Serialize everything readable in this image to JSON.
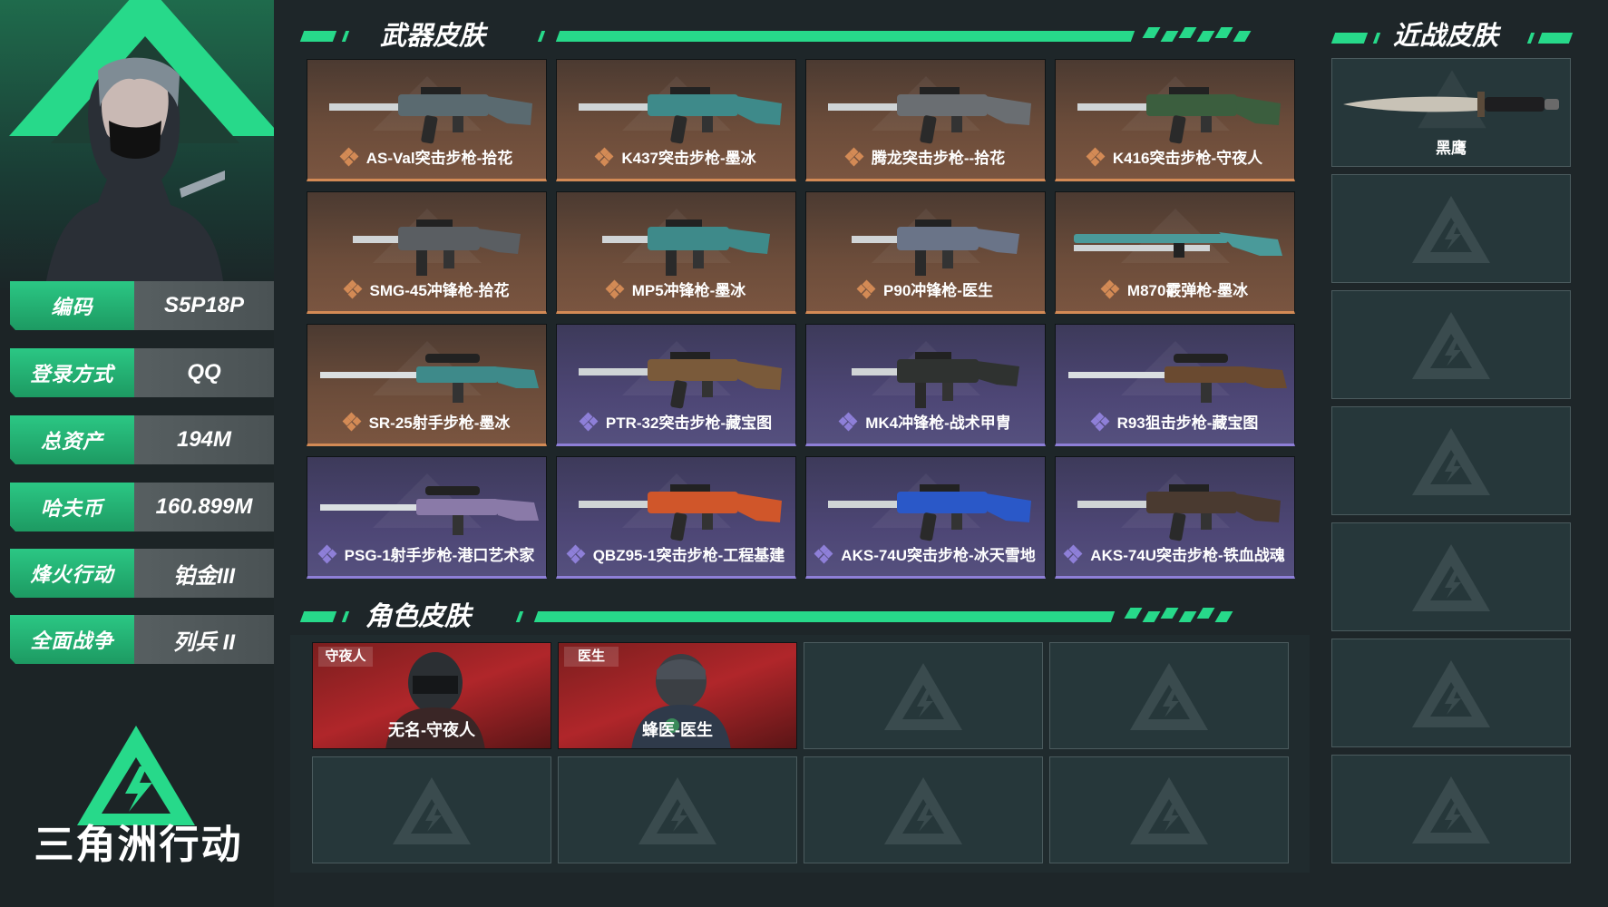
{
  "profile": {
    "rows": [
      {
        "key": "编码",
        "value": "S5P18P"
      },
      {
        "key": "登录方式",
        "value": "QQ"
      },
      {
        "key": "总资产",
        "value": "194M"
      },
      {
        "key": "哈夫币",
        "value": "160.899M"
      },
      {
        "key": "烽火行动",
        "value": "铂金III"
      },
      {
        "key": "全面战争",
        "value": "列兵 II"
      }
    ],
    "logo_text": "三角洲行动"
  },
  "weapon_section": {
    "title": "武器皮肤"
  },
  "weapons": [
    {
      "name": "AS-Val突击步枪-拾花",
      "rarity": "brown",
      "icon": "rifle-icon",
      "accent": "#5a6a70"
    },
    {
      "name": "K437突击步枪-墨冰",
      "rarity": "brown",
      "icon": "rifle-icon",
      "accent": "#3e8a8a"
    },
    {
      "name": "腾龙突击步枪--拾花",
      "rarity": "brown",
      "icon": "rifle-icon",
      "accent": "#6a6e72"
    },
    {
      "name": "K416突击步枪-守夜人",
      "rarity": "brown",
      "icon": "rifle-icon",
      "accent": "#3b5e3e"
    },
    {
      "name": "SMG-45冲锋枪-拾花",
      "rarity": "brown",
      "icon": "smg-icon",
      "accent": "#5a5e62"
    },
    {
      "name": "MP5冲锋枪-墨冰",
      "rarity": "brown",
      "icon": "smg-icon",
      "accent": "#3e8a8a"
    },
    {
      "name": "P90冲锋枪-医生",
      "rarity": "brown",
      "icon": "smg-icon",
      "accent": "#6a7488"
    },
    {
      "name": "M870霰弹枪-墨冰",
      "rarity": "brown",
      "icon": "shotgun-icon",
      "accent": "#4a9a9a"
    },
    {
      "name": "SR-25射手步枪-墨冰",
      "rarity": "brown",
      "icon": "sniper-icon",
      "accent": "#3e8a8a"
    },
    {
      "name": "PTR-32突击步枪-藏宝图",
      "rarity": "purple",
      "icon": "rifle-icon",
      "accent": "#7a5a3a"
    },
    {
      "name": "MK4冲锋枪-战术甲胄",
      "rarity": "purple",
      "icon": "smg-icon",
      "accent": "#2f3230"
    },
    {
      "name": "R93狙击步枪-藏宝图",
      "rarity": "purple",
      "icon": "sniper-icon",
      "accent": "#6a4a30"
    },
    {
      "name": "PSG-1射手步枪-港口艺术家",
      "rarity": "purple",
      "icon": "sniper-icon",
      "accent": "#8a7aa8"
    },
    {
      "name": "QBZ95-1突击步枪-工程基建",
      "rarity": "purple",
      "icon": "rifle-icon",
      "accent": "#d0562a"
    },
    {
      "name": "AKS-74U突击步枪-冰天雪地",
      "rarity": "purple",
      "icon": "rifle-icon",
      "accent": "#2a58c8"
    },
    {
      "name": "AKS-74U突击步枪-铁血战魂",
      "rarity": "purple",
      "icon": "rifle-icon",
      "accent": "#4a3a30"
    }
  ],
  "character_section": {
    "title": "角色皮肤"
  },
  "characters": [
    {
      "name": "无名-守夜人",
      "tag": "守夜人"
    },
    {
      "name": "蜂医-医生",
      "tag": "医生"
    }
  ],
  "melee_section": {
    "title": "近战皮肤"
  },
  "melee": [
    {
      "name": "黑鹰",
      "icon": "knife-icon"
    }
  ],
  "colors": {
    "accent": "#27d98a",
    "brown_edge": "#d38a55",
    "purple_edge": "#8e7fd8"
  }
}
